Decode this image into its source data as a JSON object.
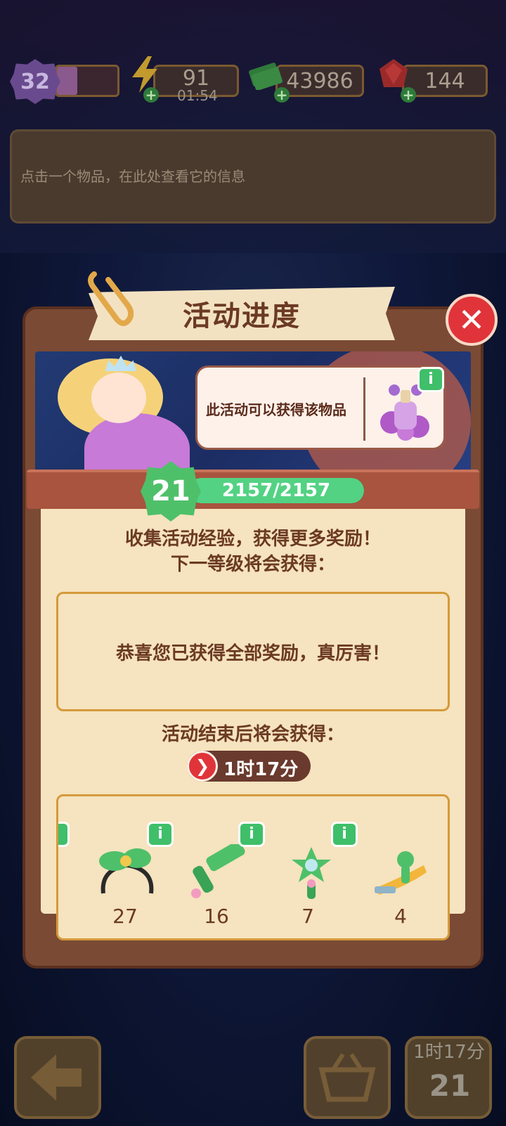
{
  "status_bar": {
    "level": "32",
    "energy": "91",
    "energy_timer": "01:54",
    "cash": "43986",
    "gems": "144"
  },
  "info_panel": {
    "hint": "点击一个物品，在此处查看它的信息"
  },
  "modal": {
    "title": "活动进度",
    "tooltip": "此活动可以获得该物品",
    "event_level": "21",
    "progress_text": "2157/2157",
    "progress_fraction": 1.0,
    "desc_line1": "收集活动经验，获得更多奖励！",
    "desc_line2": "下一等级将会获得：",
    "reward_message": "恭喜您已获得全部奖励，真厉害！",
    "end_label": "活动结束后将会获得：",
    "time_left": "1时17分",
    "items": [
      {
        "icon": "green-bow-headband-icon",
        "count": "27"
      },
      {
        "icon": "green-comb-icon",
        "count": "16"
      },
      {
        "icon": "star-mirror-wand-icon",
        "count": "7"
      },
      {
        "icon": "hair-clip-icon",
        "count": "4"
      }
    ]
  },
  "bottom_bar": {
    "timer": "1时17分",
    "level": "21"
  },
  "colors": {
    "panel_bg": "#f6e3bf",
    "panel_border": "#7a4a34",
    "text_brown": "#6b3a22",
    "progress_green": "#53d283",
    "close_red": "#e0343a",
    "info_green": "#3fbf6a"
  }
}
